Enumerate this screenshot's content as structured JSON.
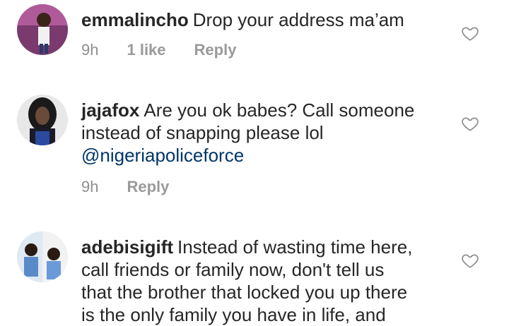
{
  "comments": [
    {
      "username": "emmalincho",
      "text": "Drop your address ma’am",
      "time": "9h",
      "likes": "1 like",
      "reply_label": "Reply",
      "avatar_icon": "user-avatar",
      "like_icon": "heart-outline-icon"
    },
    {
      "username": "jajafox",
      "text_line1": "Are you ok babes? Call someone",
      "text_line2": "instead of snapping please lol",
      "mention": "@nigeriapoliceforce",
      "time": "9h",
      "reply_label": "Reply",
      "avatar_icon": "user-avatar",
      "like_icon": "heart-outline-icon"
    },
    {
      "username": "adebisigift",
      "text_line1": "Instead of wasting time here,",
      "text_line2": "call friends or family now,  don't tell us",
      "text_line3": "that the brother that locked you up there",
      "text_line4": "is the only family you have in life, and",
      "avatar_icon": "user-avatar",
      "like_icon": "heart-outline-icon"
    }
  ],
  "colors": {
    "text": "#262626",
    "meta": "#8e8e8e",
    "mention": "#003569"
  }
}
